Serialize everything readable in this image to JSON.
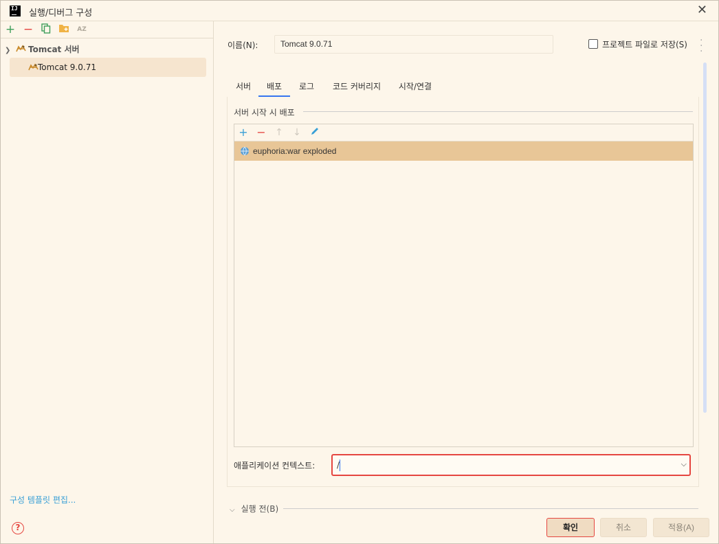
{
  "window": {
    "title": "실행/디버그 구성",
    "logo_text": "IJ"
  },
  "left_panel": {
    "tree": {
      "group_label": "Tomcat 서버",
      "child_label": "Tomcat 9.0.71"
    },
    "edit_templates_link": "구성 템플릿 편집..."
  },
  "config": {
    "name_label": "이름(N):",
    "name_value": "Tomcat 9.0.71",
    "store_as_project_file_label": "프로젝트 파일로 저장(S)",
    "store_as_project_file_checked": false
  },
  "tabs": [
    {
      "label": "서버",
      "active": false
    },
    {
      "label": "배포",
      "active": true
    },
    {
      "label": "로그",
      "active": false
    },
    {
      "label": "코드 커버리지",
      "active": false
    },
    {
      "label": "시작/연결",
      "active": false
    }
  ],
  "deployment": {
    "section_title": "서버 시작 시 배포",
    "artifacts": [
      "euphoria:war exploded"
    ],
    "context_label": "애플리케이션 컨텍스트:",
    "context_value": "/"
  },
  "before_launch": {
    "label": "실행 전(B)"
  },
  "buttons": {
    "ok": "확인",
    "cancel": "취소",
    "apply": "적용(A)",
    "help": "?"
  },
  "colors": {
    "accent": "#3574f0",
    "focus_ring": "#e5453f",
    "selection": "#e8c697",
    "background": "#fdf6ea",
    "link": "#389fd6"
  }
}
